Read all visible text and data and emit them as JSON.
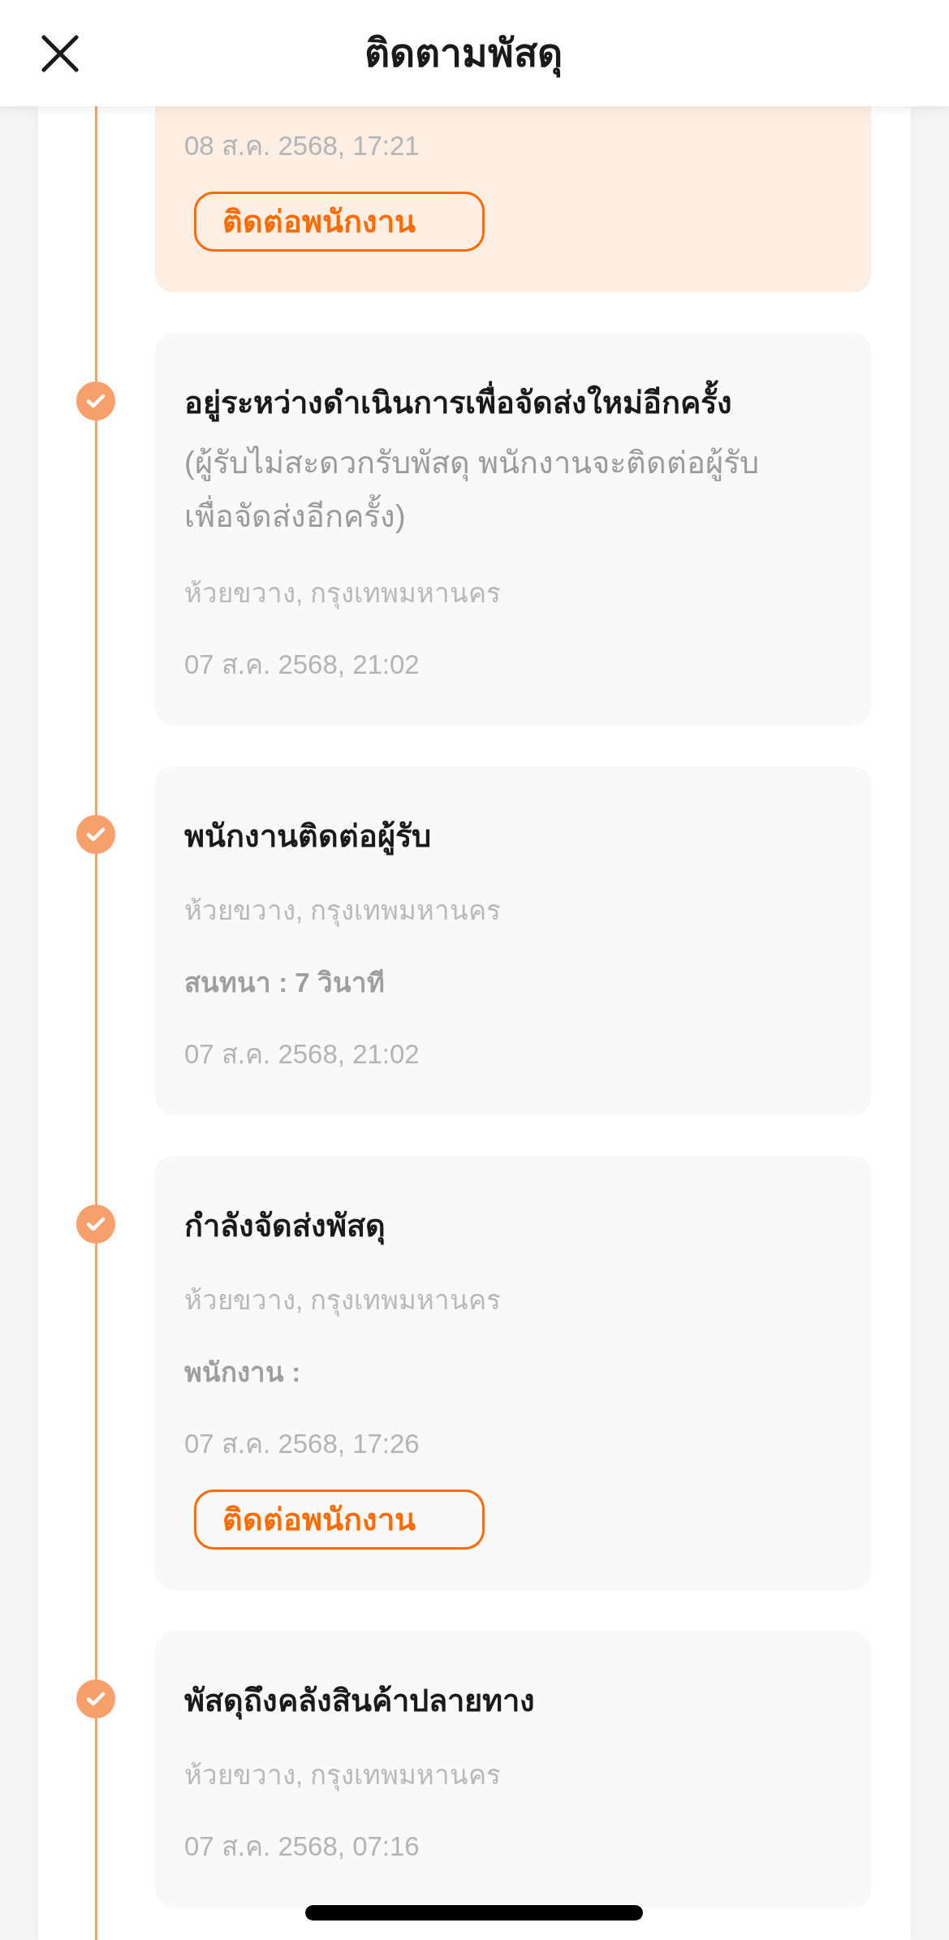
{
  "header": {
    "title": "ติดตามพัสดุ"
  },
  "events": [
    {
      "highlighted": true,
      "time": "08 ส.ค. 2568, 17:21",
      "button": "ติดต่อพนักงาน"
    },
    {
      "highlighted": false,
      "title": "อยู่ระหว่างดำเนินการเพื่อจัดส่งใหม่อีกครั้ง",
      "description": "(ผู้รับไม่สะดวกรับพัสดุ พนักงานจะติดต่อผู้รับเพื่อจัดส่งอีกครั้ง)",
      "location": "ห้วยขวาง, กรุงเทพมหานคร",
      "time": "07 ส.ค. 2568, 21:02"
    },
    {
      "highlighted": false,
      "title": "พนักงานติดต่อผู้รับ",
      "location": "ห้วยขวาง, กรุงเทพมหานคร",
      "detail": "สนทนา : 7 วินาที",
      "time": "07 ส.ค. 2568, 21:02"
    },
    {
      "highlighted": false,
      "title": "กำลังจัดส่งพัสดุ",
      "location": "ห้วยขวาง, กรุงเทพมหานคร",
      "detail": "พนักงาน :",
      "time": "07 ส.ค. 2568, 17:26",
      "button": "ติดต่อพนักงาน"
    },
    {
      "highlighted": false,
      "title": "พัสดุถึงคลังสินค้าปลายทาง",
      "location": "ห้วยขวาง, กรุงเทพมหานคร",
      "time": "07 ส.ค. 2568, 07:16"
    }
  ]
}
